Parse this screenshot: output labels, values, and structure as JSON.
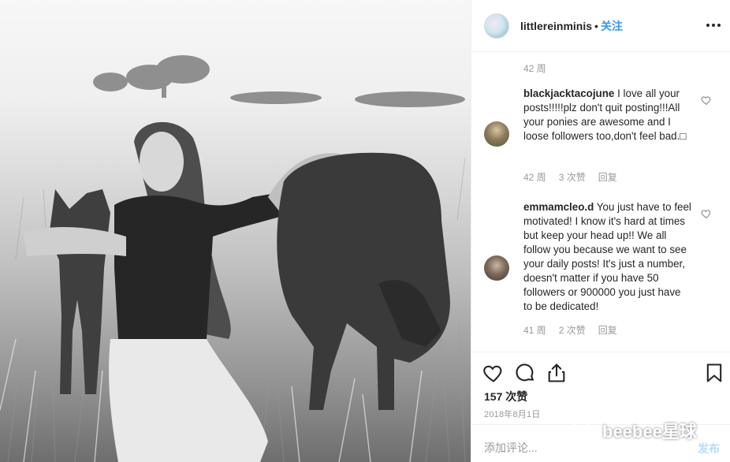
{
  "post": {
    "username": "littlereinminis",
    "separator": "•",
    "follow_label": "关注",
    "more_icon": "more-horizontal-icon"
  },
  "comments": {
    "first_meta": "42 周",
    "items": [
      {
        "username": "blackjacktacojune",
        "text": "I love all your posts!!!!!plz don't quit posting!!!All your ponies are awesome and I loose followers too,don't feel bad.□",
        "age": "42 周",
        "likes": "3 次赞",
        "reply_label": "回复"
      },
      {
        "username": "emmamcleo.d",
        "text": "You just have to feel motivated! I know it's hard at times but keep your head up!! We all follow you because we want to see your daily posts! It's just a number, doesn't matter if you have 50 followers or 900000 you just have to be dedicated!",
        "age": "41 周",
        "likes": "2 次赞",
        "reply_label": "回复"
      }
    ]
  },
  "actions": {
    "icons": [
      "heart-icon",
      "comment-icon",
      "share-icon",
      "bookmark-icon"
    ],
    "likes": "157 次赞",
    "date": "2018年8月1日"
  },
  "composer": {
    "placeholder": "添加评论...",
    "post_label": "发布"
  },
  "watermark": {
    "text": "beebee星球"
  },
  "colors": {
    "link": "#3897f0",
    "muted": "#999999",
    "border": "#efefef",
    "post_disabled": "#b3dbff"
  }
}
